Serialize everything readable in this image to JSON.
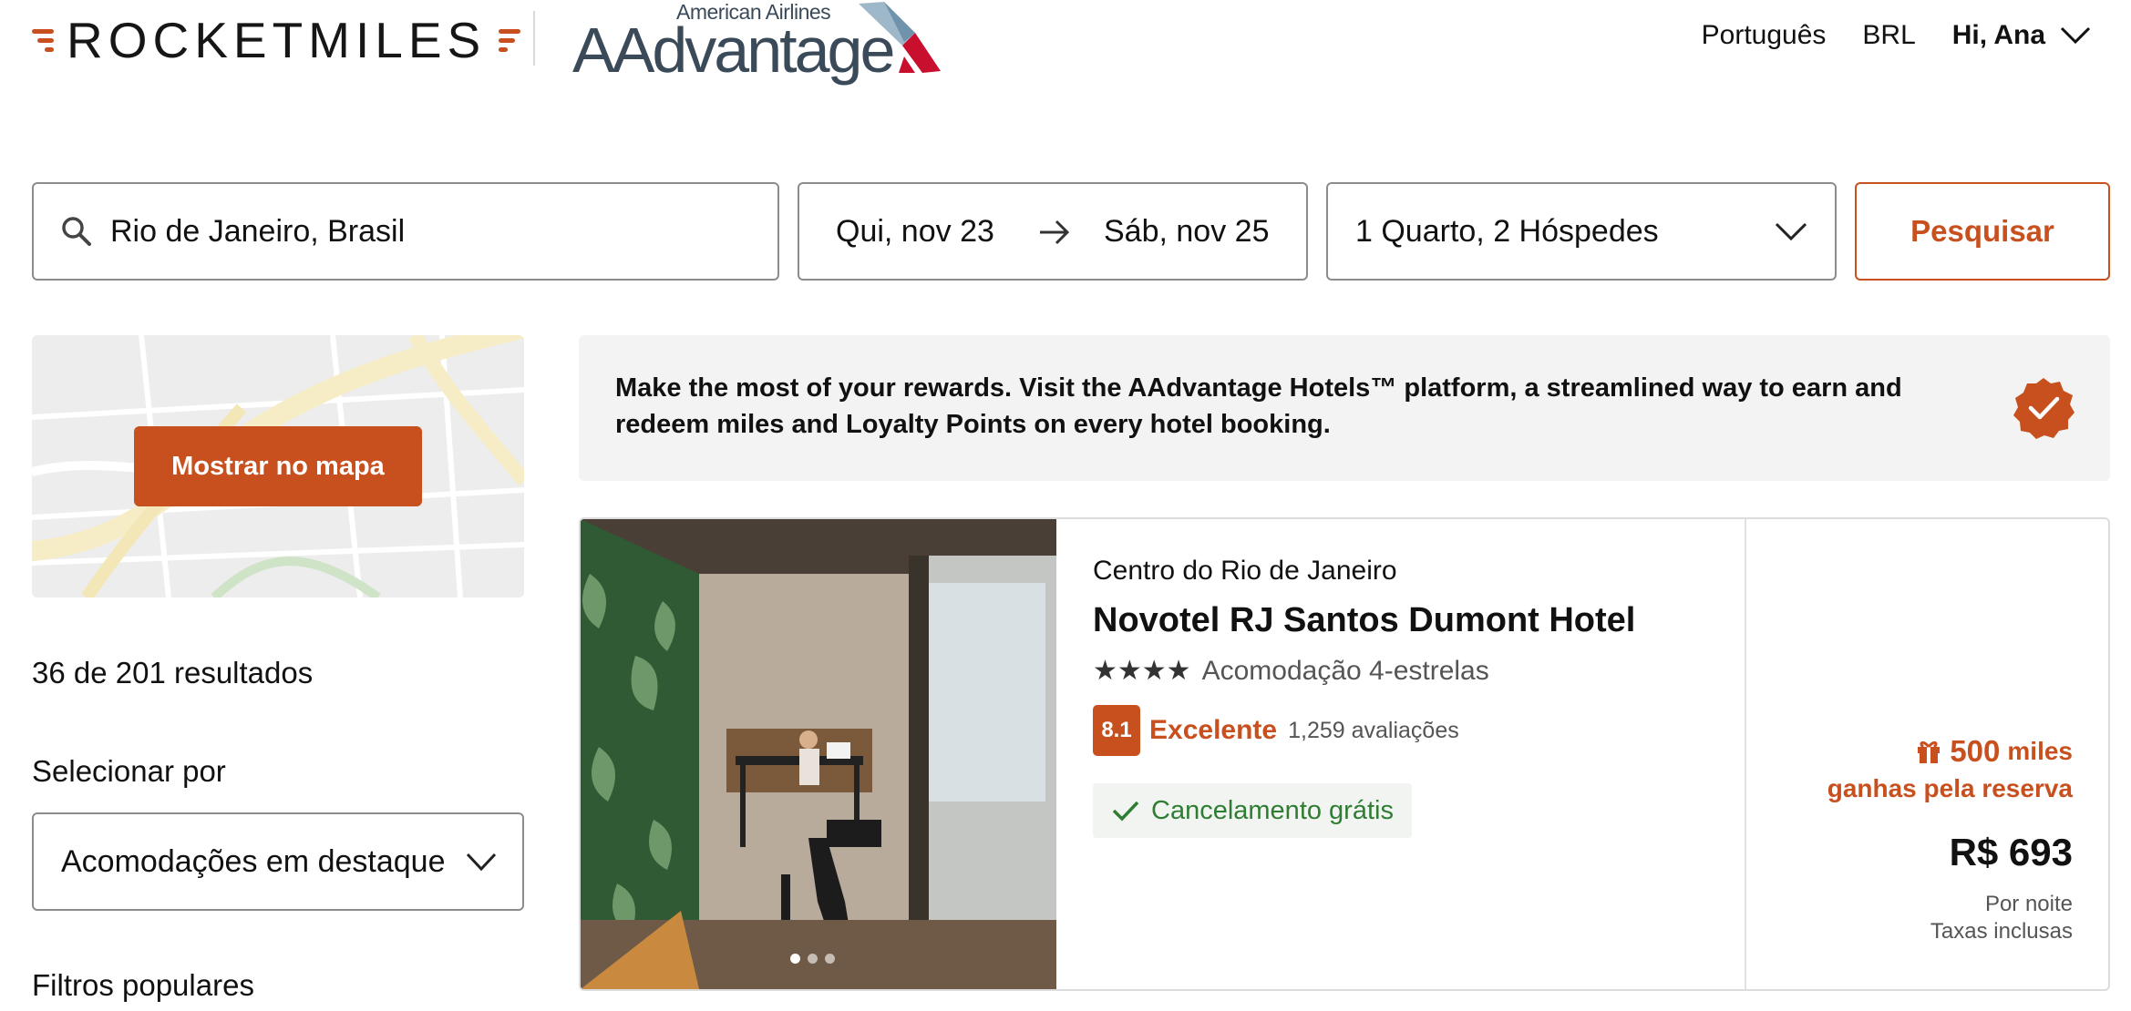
{
  "header": {
    "brand": "ROCKETMILES",
    "partner_small": "American Airlines",
    "partner_big": "AAdvantage",
    "language": "Português",
    "currency": "BRL",
    "user_greeting": "Hi, Ana"
  },
  "search": {
    "location": "Rio de Janeiro, Brasil",
    "checkin": "Qui, nov 23",
    "checkout": "Sáb, nov 25",
    "guests": "1 Quarto, 2 Hóspedes",
    "button_label": "Pesquisar"
  },
  "sidebar": {
    "map_button": "Mostrar no mapa",
    "results_count": "36 de 201 resultados",
    "sort_label": "Selecionar por",
    "sort_value": "Acomodações em destaque",
    "filters_heading": "Filtros populares"
  },
  "banner": {
    "text": "Make the most of your rewards. Visit the AAdvantage Hotels™ platform, a streamlined way to earn and redeem miles and Loyalty Points on every hotel booking."
  },
  "hotel": {
    "neighborhood": "Centro do Rio de Janeiro",
    "name": "Novotel RJ Santos Dumont Hotel",
    "stars": 4,
    "stars_glyphs": "★★★★",
    "class_label": "Acomodação 4-estrelas",
    "score": "8.1",
    "rating_label": "Excelente",
    "reviews": "1,259 avaliações",
    "cancellation": "Cancelamento grátis",
    "miles_amount": "500",
    "miles_unit": "miles",
    "miles_note": "ganhas pela reserva",
    "price": "R$ 693",
    "price_note_1": "Por noite",
    "price_note_2": "Taxas inclusas",
    "photo_count": 3,
    "active_photo": 1
  },
  "colors": {
    "accent": "#c8501e",
    "success": "#2f7d32",
    "banner_bg": "#f3f3f3"
  }
}
